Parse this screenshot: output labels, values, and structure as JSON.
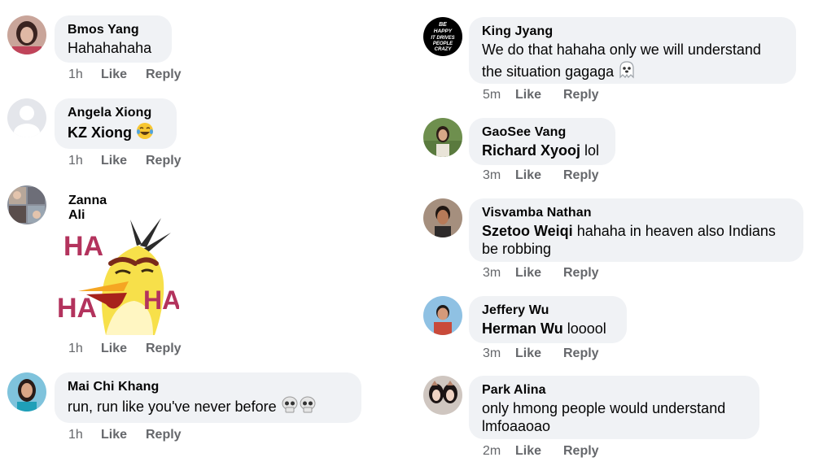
{
  "left": [
    {
      "author": "Bmos Yang",
      "text": "Hahahahaha",
      "time": "1h",
      "like": "Like",
      "reply": "Reply"
    },
    {
      "author": "Angela Xiong",
      "mention": "KZ Xiong",
      "text": "",
      "emoji": "laughing-tears",
      "time": "1h",
      "like": "Like",
      "reply": "Reply"
    },
    {
      "author": "Zanna Ali",
      "sticker_text": [
        "HA",
        "HA",
        "HA"
      ],
      "time": "1h",
      "like": "Like",
      "reply": "Reply"
    },
    {
      "author": "Mai Chi Khang",
      "text": "run, run like you've never before",
      "emoji": "skull",
      "time": "1h",
      "like": "Like",
      "reply": "Reply"
    }
  ],
  "right": [
    {
      "author": "King Jyang",
      "text_line1": "We do that hahaha only we will understand",
      "text_line2": "the situation gagaga",
      "emoji": "ghost",
      "avatar_text": [
        "BE",
        "HAPPY",
        "IT DRIVES",
        "PEOPLE",
        "CRAZY"
      ],
      "time": "5m",
      "like": "Like",
      "reply": "Reply"
    },
    {
      "author": "GaoSee Vang",
      "mention": "Richard Xyooj",
      "text": " lol",
      "time": "3m",
      "like": "Like",
      "reply": "Reply"
    },
    {
      "author": "Visvamba Nathan",
      "mention": "Szetoo Weiqi",
      "text": " hahaha in heaven also Indians",
      "text_line2": "be robbing",
      "time": "3m",
      "like": "Like",
      "reply": "Reply"
    },
    {
      "author": "Jeffery Wu",
      "mention": "Herman Wu",
      "text": " looool",
      "time": "3m",
      "like": "Like",
      "reply": "Reply"
    },
    {
      "author": "Park Alina",
      "text_line1": "only hmong people would understand",
      "text_line2": "lmfoaaoao",
      "time": "2m",
      "like": "Like",
      "reply": "Reply"
    }
  ],
  "colors": {
    "bubble": "#f0f2f5",
    "meta": "#65676b",
    "text": "#050505"
  }
}
